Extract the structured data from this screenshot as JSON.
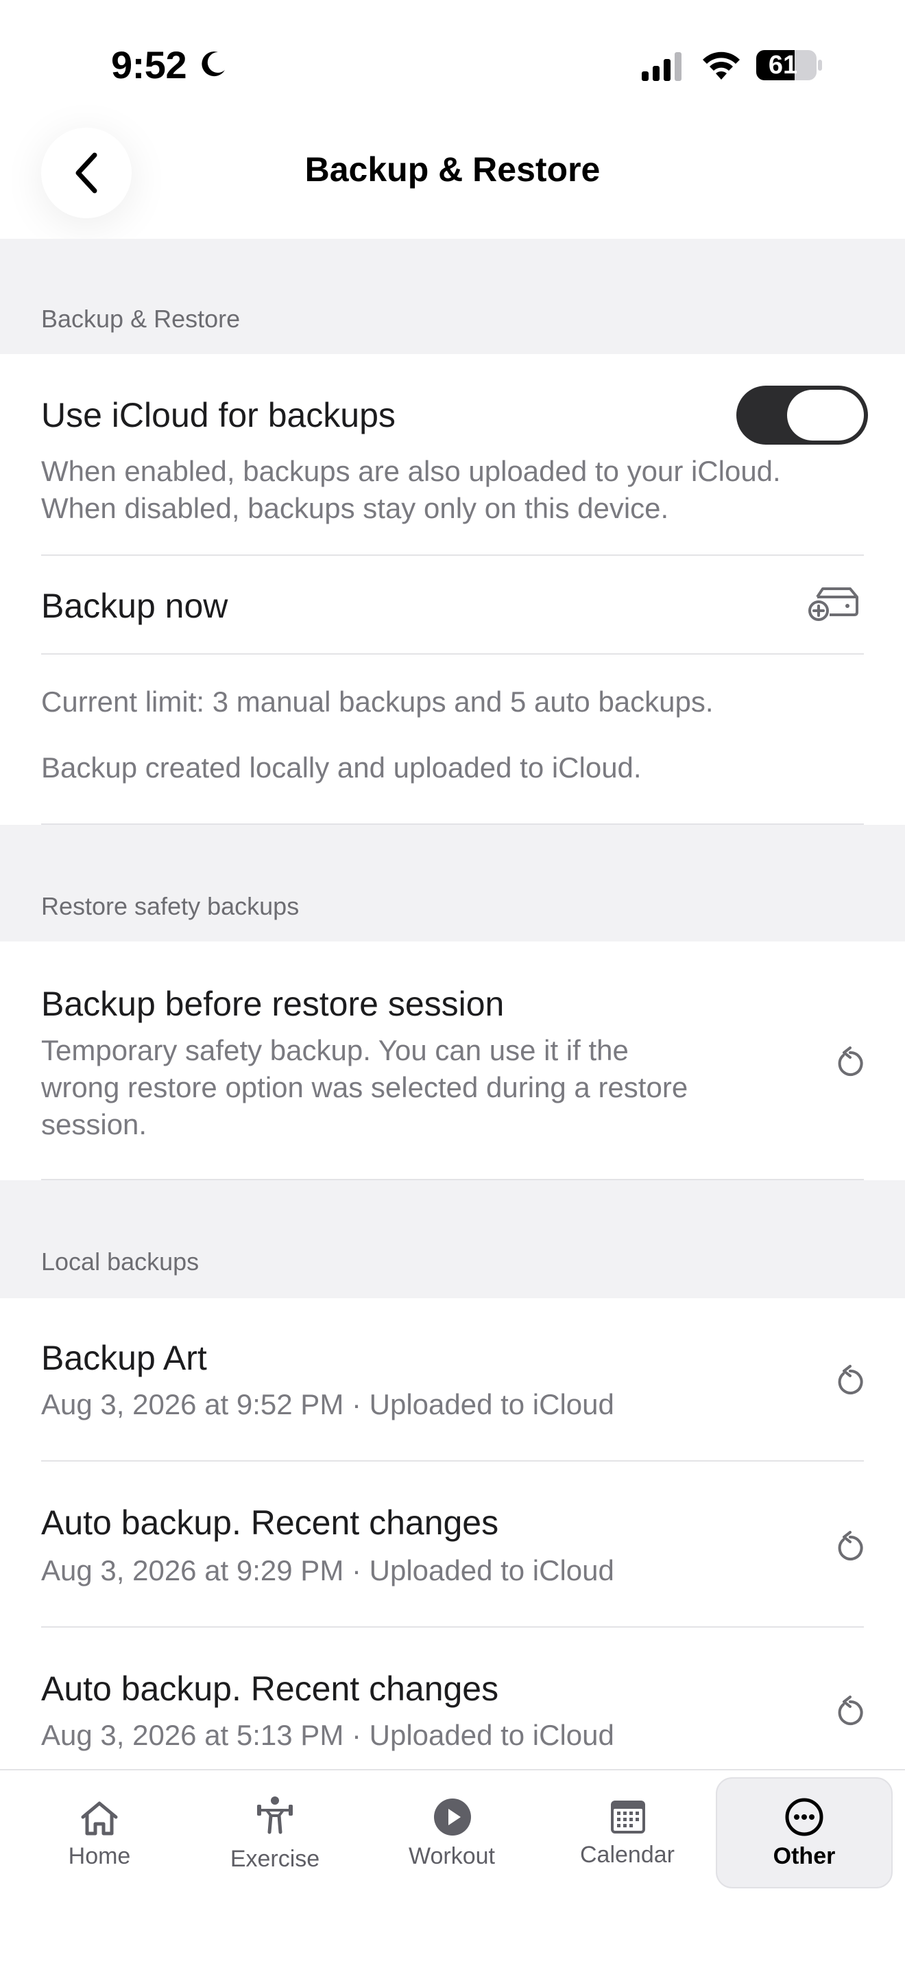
{
  "status_bar": {
    "time": "9:52",
    "battery": "61"
  },
  "header": {
    "title": "Backup & Restore"
  },
  "sections": {
    "backup": {
      "header": "Backup & Restore",
      "icloud_title": "Use iCloud for backups",
      "icloud_desc_1": "When enabled, backups are also uploaded to your iCloud.",
      "icloud_desc_2": "When disabled, backups stay only on this device.",
      "icloud_enabled": true,
      "backup_now": "Backup now",
      "limit_text": "Current limit: 3 manual backups and 5 auto backups.",
      "status_text": "Backup created locally and uploaded to iCloud."
    },
    "restore_safety": {
      "header": "Restore safety backups",
      "title": "Backup before restore session",
      "desc_1": "Temporary safety backup. You can use it if the",
      "desc_2": "wrong restore option was selected during a restore",
      "desc_3": "session."
    },
    "local": {
      "header": "Local backups",
      "items": [
        {
          "title": "Backup Art",
          "subtitle": "Aug 3, 2026 at 9:52 PM · Uploaded to iCloud"
        },
        {
          "title": "Auto backup. Recent changes",
          "subtitle": "Aug 3, 2026 at 9:29 PM · Uploaded to iCloud"
        },
        {
          "title": "Auto backup. Recent changes",
          "subtitle": "Aug 3, 2026 at 5:13 PM · Uploaded to iCloud"
        }
      ]
    }
  },
  "tabs": [
    {
      "label": "Home",
      "icon": "home-icon"
    },
    {
      "label": "Exercise",
      "icon": "exercise-icon"
    },
    {
      "label": "Workout",
      "icon": "play-icon"
    },
    {
      "label": "Calendar",
      "icon": "calendar-icon"
    },
    {
      "label": "Other",
      "icon": "more-icon",
      "active": true
    }
  ],
  "colors": {
    "toggle_on": "#2c2c2e",
    "section_bg": "#f2f2f4",
    "secondary_text": "#7a7a80"
  }
}
